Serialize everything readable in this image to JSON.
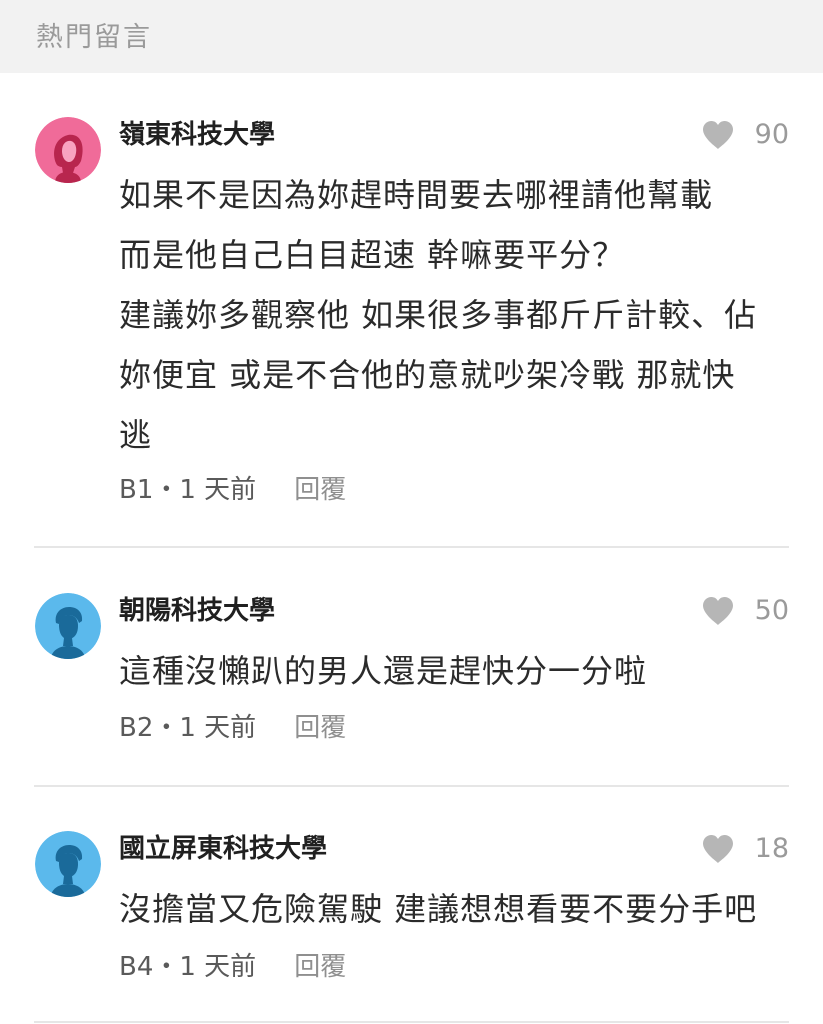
{
  "section": {
    "title": "熱門留言"
  },
  "colors": {
    "header_bg": "#f2f2f2",
    "avatar_female": "#f06b99",
    "avatar_male": "#5bb9ec",
    "heart": "#b6b6b6"
  },
  "comments": [
    {
      "author": "嶺東科技大學",
      "avatar_icon": "female-avatar-icon",
      "likes": "90",
      "lines": [
        "如果不是因為妳趕時間要去哪裡請他幫載",
        "而是他自己白目超速 幹嘛要平分？",
        "建議妳多觀察他 如果很多事都斤斤計較、佔",
        "妳便宜 或是不合他的意就吵架冷戰 那就快",
        "逃"
      ],
      "meta": "B1・1 天前",
      "reply": "回覆"
    },
    {
      "author": "朝陽科技大學",
      "avatar_icon": "male-avatar-icon",
      "likes": "50",
      "lines": [
        "這種沒懶趴的男人還是趕快分一分啦"
      ],
      "meta": "B2・1 天前",
      "reply": "回覆"
    },
    {
      "author": "國立屏東科技大學",
      "avatar_icon": "male-avatar-icon",
      "likes": "18",
      "lines": [
        "沒擔當又危險駕駛 建議想想看要不要分手吧"
      ],
      "meta": "B4・1 天前",
      "reply": "回覆"
    }
  ]
}
